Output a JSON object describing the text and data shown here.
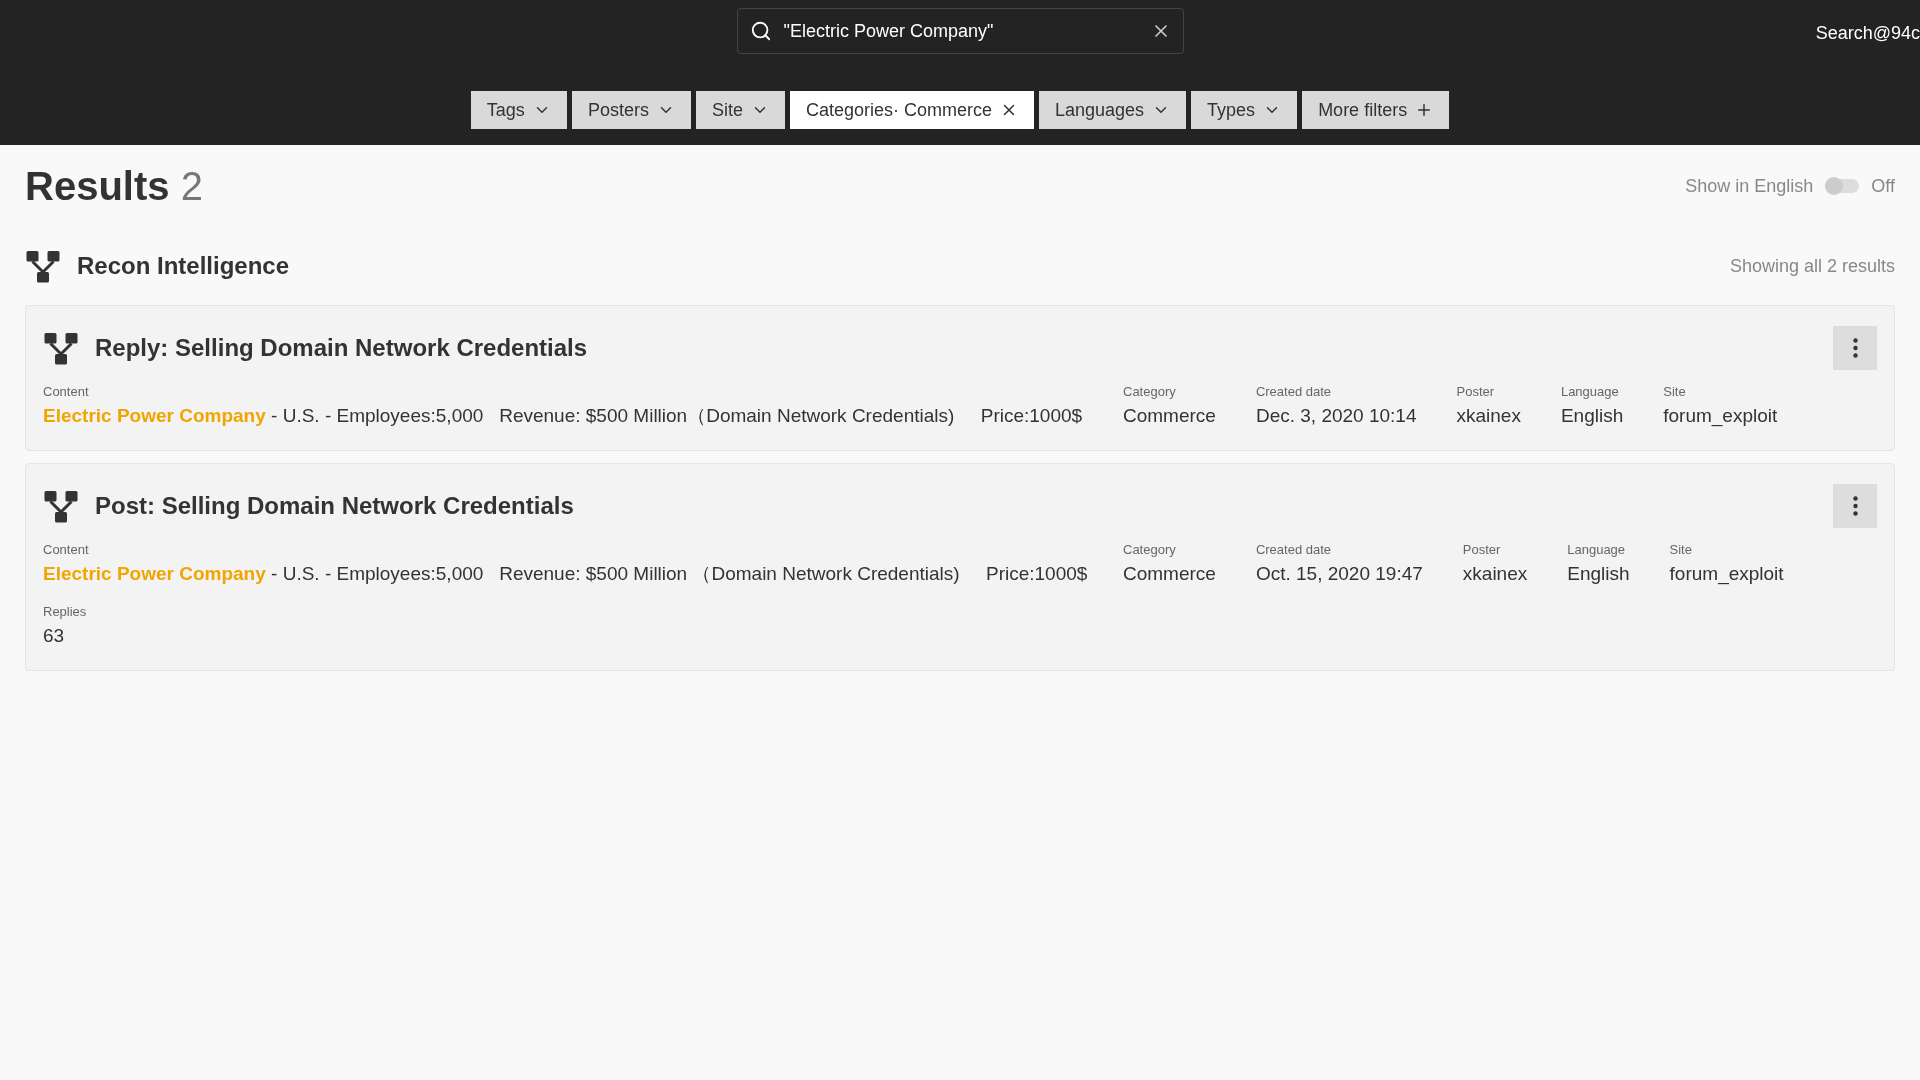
{
  "search": {
    "value": "\"Electric Power Company\""
  },
  "user": "Search@94c",
  "filters": [
    {
      "label": "Tags",
      "selected": false,
      "kind": "dropdown"
    },
    {
      "label": "Posters",
      "selected": false,
      "kind": "dropdown"
    },
    {
      "label": "Site",
      "selected": false,
      "kind": "dropdown"
    },
    {
      "label": "Categories· Commerce",
      "selected": true,
      "kind": "removable"
    },
    {
      "label": "Languages",
      "selected": false,
      "kind": "dropdown"
    },
    {
      "label": "Types",
      "selected": false,
      "kind": "dropdown"
    },
    {
      "label": "More filters",
      "selected": false,
      "kind": "add"
    }
  ],
  "results": {
    "title": "Results",
    "count": "2"
  },
  "show_in_english": {
    "label": "Show in English",
    "on": false,
    "state": "Off"
  },
  "group": {
    "title": "Recon Intelligence",
    "summary": "Showing all 2 results"
  },
  "cards": [
    {
      "title": "Reply: Selling Domain Network Credentials",
      "content_label": "Content",
      "content": "**Electric Power Company** - U.S. - Employees:5,000   Revenue: $500 Million（Domain Network Credentials)     Price:1000$",
      "fields": [
        {
          "label": "Category",
          "value": "Commerce"
        },
        {
          "label": "Created date",
          "value": "Dec. 3, 2020 10:14"
        },
        {
          "label": "Poster",
          "value": "xkainex"
        },
        {
          "label": "Language",
          "value": "English"
        },
        {
          "label": "Site",
          "value": "forum_exploit"
        }
      ]
    },
    {
      "title": "Post: Selling Domain Network Credentials",
      "content_label": "Content",
      "content": "**Electric Power Company** - U.S. - Employees:5,000   Revenue: $500 Million （Domain Network Credentials)     Price:1000$",
      "fields": [
        {
          "label": "Category",
          "value": "Commerce"
        },
        {
          "label": "Created date",
          "value": "Oct. 15, 2020 19:47"
        },
        {
          "label": "Poster",
          "value": "xkainex"
        },
        {
          "label": "Language",
          "value": "English"
        },
        {
          "label": "Site",
          "value": "forum_exploit"
        }
      ],
      "extra": {
        "label": "Replies",
        "value": "63"
      }
    }
  ]
}
